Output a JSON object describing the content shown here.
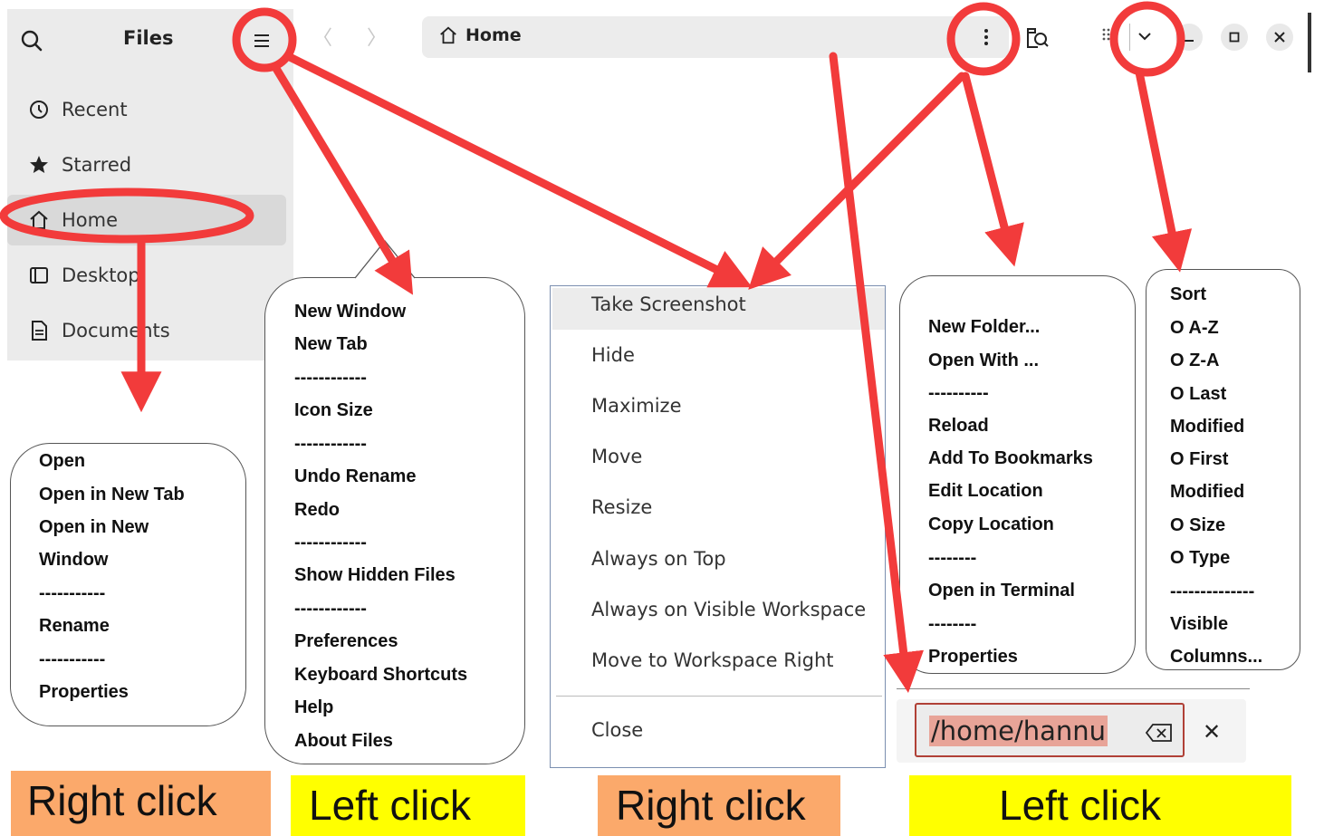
{
  "files_window": {
    "title": "Files",
    "sidebar_items": [
      {
        "label": "Recent",
        "icon": "clock-icon"
      },
      {
        "label": "Starred",
        "icon": "star-icon"
      },
      {
        "label": "Home",
        "icon": "home-icon"
      },
      {
        "label": "Desktop",
        "icon": "desktop-icon"
      },
      {
        "label": "Documents",
        "icon": "document-icon"
      }
    ],
    "nav_back": "〈",
    "nav_forward": "〉",
    "path_label": "Home"
  },
  "sidebar_context_menu": {
    "items": [
      "Open",
      "Open in New Tab",
      "Open in New",
      "Window",
      "-----------",
      "Rename",
      "-----------",
      "Properties"
    ]
  },
  "main_menu": {
    "items": [
      "New Window",
      "New Tab",
      "------------",
      "Icon Size",
      "------------",
      "Undo Rename",
      "Redo",
      "------------",
      "Show Hidden Files",
      "------------",
      "Preferences",
      "Keyboard Shortcuts",
      "Help",
      "About Files"
    ]
  },
  "window_context_menu": {
    "items": [
      "Take Screenshot",
      "Hide",
      "Maximize",
      "Move",
      "Resize",
      "Always on Top",
      "Always on Visible Workspace",
      "Move to Workspace Right"
    ],
    "close_label": "Close"
  },
  "path_menu": {
    "items": [
      "New Folder...",
      "Open With ...",
      "----------",
      "Reload",
      "Add To Bookmarks",
      "Edit Location",
      "Copy Location",
      "--------",
      "Open in Terminal",
      "--------",
      "Properties"
    ]
  },
  "view_menu": {
    "items": [
      "Sort",
      "O  A-Z",
      "O Z-A",
      "O Last",
      "Modified",
      "O First",
      "Modified",
      "O Size",
      "O Type",
      "--------------",
      "Visible",
      "Columns..."
    ]
  },
  "location_bar": {
    "value": "/home/hannu",
    "close_symbol": "✕"
  },
  "labels": {
    "label_1": "Right click",
    "label_2": "Left click",
    "label_3": "Right click",
    "label_4": "Left click"
  },
  "colors": {
    "annotation_red": "#f23b3b",
    "orange_label": "#fba96b",
    "yellow_label": "#ffff00"
  }
}
